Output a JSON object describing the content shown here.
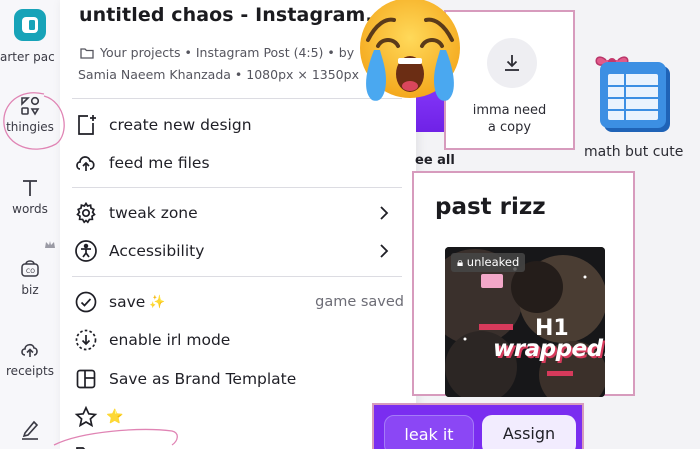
{
  "rail": {
    "items": [
      {
        "label": "tarter pac",
        "icon": "starter-pack-icon"
      },
      {
        "label": "thingies",
        "icon": "elements-icon"
      },
      {
        "label": "words",
        "icon": "text-icon"
      },
      {
        "label": "biz",
        "icon": "brand-icon"
      },
      {
        "label": "receipts",
        "icon": "uploads-icon"
      },
      {
        "label": "",
        "icon": "draw-icon"
      }
    ]
  },
  "panel": {
    "title": "untitled chaos - Instagram...",
    "meta_line1": "Your projects • Instagram Post (4:5) • by",
    "meta_line2": "Samia Naeem Khanzada • 1080px × 1350px",
    "menu": {
      "create": "create new design",
      "import": "feed me files",
      "settings": "tweak zone",
      "accessibility": "Accessibility",
      "save": "save",
      "save_status": "game saved",
      "offline": "enable irl mode",
      "brand_template": "Save as Brand Template"
    }
  },
  "right": {
    "see_all": "ee all",
    "copy_card_text_1": "imma need",
    "copy_card_text_2": "a copy",
    "math_label": "math but cute",
    "rizz_title": "past rizz",
    "thumb_badge": "unleaked",
    "thumb_h1": "H1",
    "thumb_wrapped": "wrapped!"
  },
  "actions": {
    "leak": "leak it",
    "assign": "Assign"
  },
  "colors": {
    "accent_purple": "#7a2df0",
    "card_border_pink": "#d79bbd",
    "logo_teal": "#17a3b8",
    "sparkle_yellow": "#f1c21b"
  }
}
